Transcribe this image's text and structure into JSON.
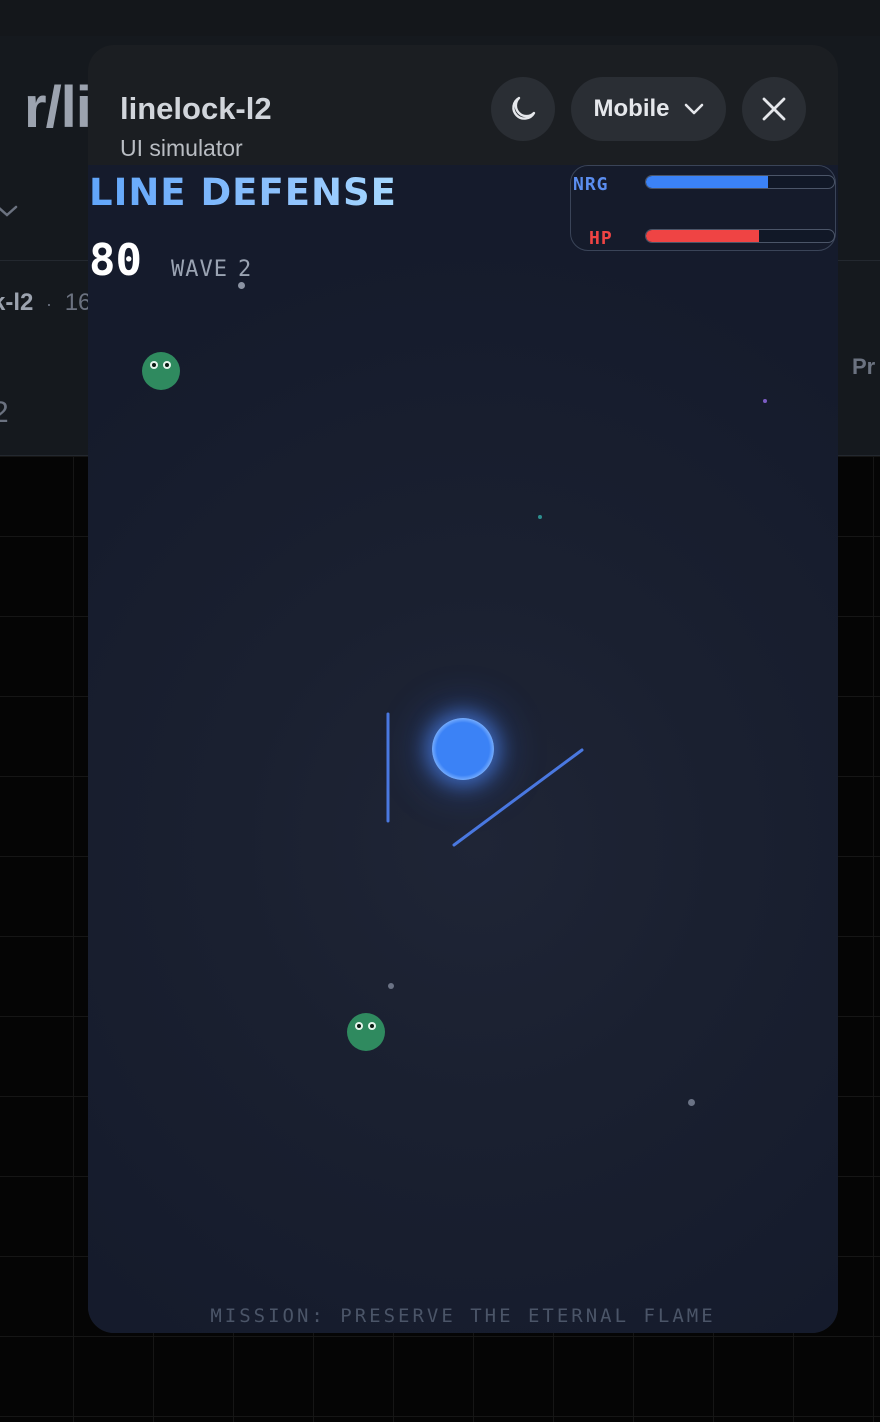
{
  "background": {
    "subreddit_partial": "r/li",
    "post_meta_partial_name": "k-l2",
    "post_meta_partial_sep": "·",
    "post_meta_partial_num": "16",
    "side_number_partial": "2",
    "right_text_partial": "Pr"
  },
  "modal": {
    "title": "linelock-l2",
    "subtitle": "UI simulator",
    "theme_toggle_icon": "moon-icon",
    "device_select": {
      "selected": "Mobile",
      "icon": "chevron-down-icon"
    },
    "close_icon": "close-icon"
  },
  "game": {
    "title": "LINE DEFENSE",
    "score": "80",
    "wave_label": "WAVE",
    "wave_number": "2",
    "stats": {
      "energy_label": "NRG",
      "energy_level": 0.65,
      "hp_label": "HP",
      "hp_level": 0.6
    },
    "mission_text": "MISSION: PRESERVE THE ETERNAL FLAME",
    "colors": {
      "energy": "#3b82f6",
      "hp": "#ef4444",
      "enemy": "#2f8a5f",
      "drawn_line": "#4a78e0",
      "core": "#3b82f6"
    }
  }
}
